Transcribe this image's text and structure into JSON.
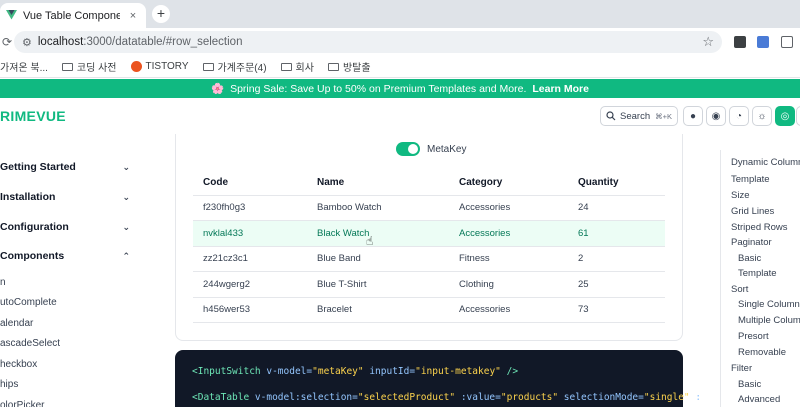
{
  "browser": {
    "tab_title": "Vue Table Component",
    "tab_close": "×",
    "new_tab": "+",
    "url_host": "localhost",
    "url_rest": ":3000/datatable/#row_selection",
    "bookmarks": [
      "가져온 북...",
      "코딩 사전",
      "TISTORY",
      "가계주문(4)",
      "회사",
      "방탈출"
    ]
  },
  "banner": {
    "emoji": "🌸",
    "text": "Spring Sale: Save Up to 50% on Premium Templates and More.",
    "cta": "Learn More"
  },
  "header": {
    "logo": "RIMEVUE",
    "search_label": "Search",
    "search_shortcut": "⌘+K"
  },
  "sidebar": {
    "categories": [
      "Getting Started",
      "Installation",
      "Configuration",
      "Components"
    ],
    "sub_items": [
      "n",
      "utoComplete",
      "alendar",
      "ascadeSelect",
      "heckbox",
      "hips",
      "olorPicker"
    ]
  },
  "demo": {
    "toggle_label": "MetaKey",
    "toggle_on": true,
    "columns": [
      "Code",
      "Name",
      "Category",
      "Quantity"
    ],
    "rows": [
      {
        "code": "f230fh0g3",
        "name": "Bamboo Watch",
        "category": "Accessories",
        "quantity": "24"
      },
      {
        "code": "nvklal433",
        "name": "Black Watch",
        "category": "Accessories",
        "quantity": "61"
      },
      {
        "code": "zz21cz3c1",
        "name": "Blue Band",
        "category": "Fitness",
        "quantity": "2"
      },
      {
        "code": "244wgerg2",
        "name": "Blue T-Shirt",
        "category": "Clothing",
        "quantity": "25"
      },
      {
        "code": "h456wer53",
        "name": "Bracelet",
        "category": "Accessories",
        "quantity": "73"
      }
    ],
    "selected_row": 1
  },
  "code": {
    "line1": {
      "tag": "<InputSwitch",
      "attrs": " v-model=",
      "v1": "\"metaKey\"",
      "attrs2": " inputId=",
      "v2": "\"input-metakey\"",
      "end": " />"
    },
    "line2": {
      "tag": "<DataTable",
      "attrs": " v-model:selection=",
      "v1": "\"selectedProduct\"",
      "attrs2": " :value=",
      "v2": "\"products\"",
      "attrs3": " selectionMode=",
      "v3": "\"single\"",
      "end": " :"
    }
  },
  "toc": {
    "items": [
      {
        "label": "Dynamic Column",
        "level": 0
      },
      {
        "label": "Template",
        "level": 0
      },
      {
        "label": "Size",
        "level": 0
      },
      {
        "label": "Grid Lines",
        "level": 0
      },
      {
        "label": "Striped Rows",
        "level": 0
      },
      {
        "label": "Paginator",
        "level": 0
      },
      {
        "label": "Basic",
        "level": 1
      },
      {
        "label": "Template",
        "level": 1
      },
      {
        "label": "Sort",
        "level": 0
      },
      {
        "label": "Single Column",
        "level": 1
      },
      {
        "label": "Multiple Column",
        "level": 1
      },
      {
        "label": "Presort",
        "level": 1
      },
      {
        "label": "Removable",
        "level": 1
      },
      {
        "label": "Filter",
        "level": 0
      },
      {
        "label": "Basic",
        "level": 1
      },
      {
        "label": "Advanced",
        "level": 1
      }
    ]
  },
  "colors": {
    "accent": "#10b981",
    "selected_bg": "#ecfdf5",
    "code_bg": "#111827"
  }
}
